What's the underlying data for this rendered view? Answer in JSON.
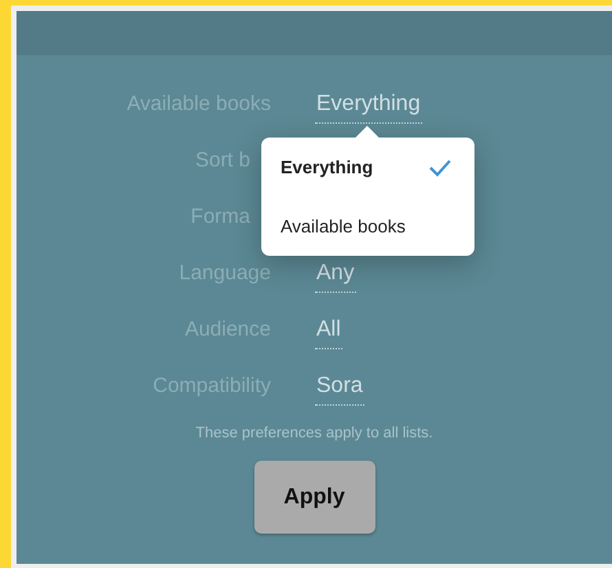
{
  "settings": [
    {
      "label": "Available books",
      "value": "Everything"
    },
    {
      "label": "Sort b"
    },
    {
      "label": "Forma"
    },
    {
      "label": "Language",
      "value": "Any"
    },
    {
      "label": "Audience",
      "value": "All"
    },
    {
      "label": "Compatibility",
      "value": "Sora"
    }
  ],
  "note": "These preferences apply to all lists.",
  "popup": {
    "options": [
      {
        "label": "Everything",
        "selected": true
      },
      {
        "label": "Available books",
        "selected": false
      }
    ]
  },
  "apply_button": "Apply"
}
